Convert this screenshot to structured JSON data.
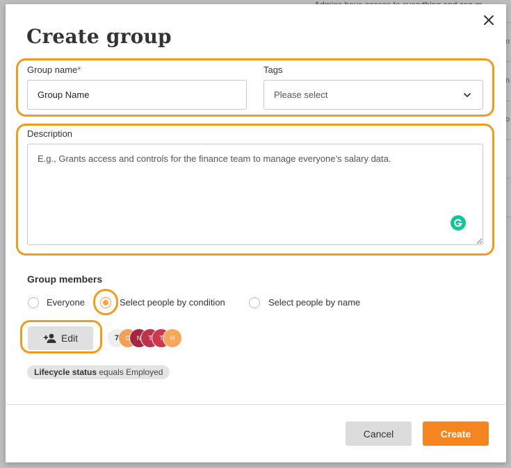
{
  "background": {
    "text": "Admins have access to everything and can m",
    "fragments": [
      "n",
      "n",
      "o"
    ]
  },
  "modal": {
    "title": "Create group",
    "close_icon": "close-icon"
  },
  "form": {
    "group_name_label": "Group name",
    "required_mark": "*",
    "group_name_value": "Group Name",
    "tags_label": "Tags",
    "tags_placeholder": "Please select",
    "description_label": "Description",
    "description_placeholder": "E.g., Grants access and controls for the finance team to manage everyone’s salary data."
  },
  "members": {
    "title": "Group members",
    "options": [
      {
        "label": "Everyone",
        "checked": false
      },
      {
        "label": "Select people by condition",
        "checked": true
      },
      {
        "label": "Select people by name",
        "checked": false
      }
    ],
    "edit_label": "Edit",
    "avatars": [
      {
        "text": "7",
        "color": "#eeeeee"
      },
      {
        "text": "G",
        "color": "#f2a057"
      },
      {
        "text": "N",
        "color": "#a8253f"
      },
      {
        "text": "T",
        "color": "#c03048"
      },
      {
        "text": "T",
        "color": "#d0374f"
      },
      {
        "text": "H",
        "color": "#f7a75a"
      }
    ],
    "condition_field": "Lifecycle status",
    "condition_rest": " equals Employed"
  },
  "footer": {
    "cancel_label": "Cancel",
    "create_label": "Create"
  },
  "colors": {
    "accent": "#f5861f",
    "highlight": "#f39a1e",
    "grammarly": "#15c39a"
  }
}
